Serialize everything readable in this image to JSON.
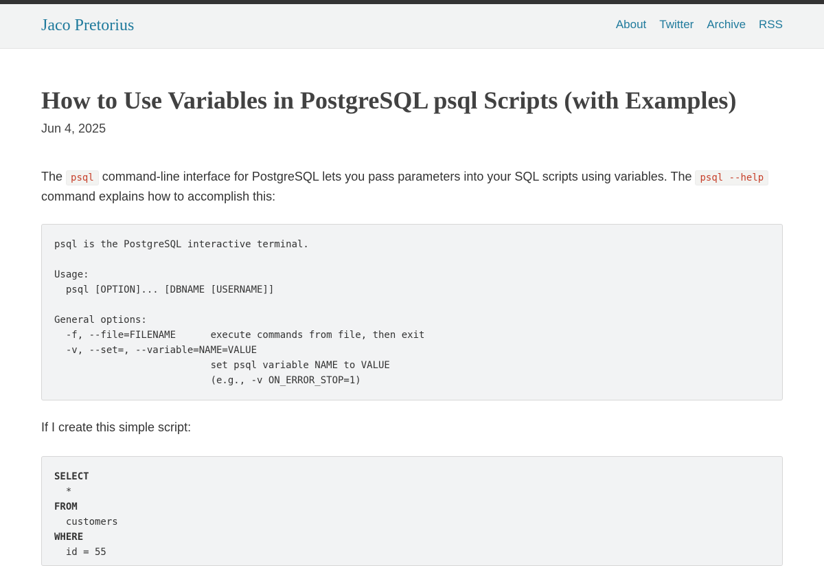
{
  "header": {
    "site_title": "Jaco Pretorius",
    "nav": [
      {
        "label": "About"
      },
      {
        "label": "Twitter"
      },
      {
        "label": "Archive"
      },
      {
        "label": "RSS"
      }
    ]
  },
  "post": {
    "title": "How to Use Variables in PostgreSQL psql Scripts (with Examples)",
    "date": "Jun 4, 2025",
    "intro": {
      "t1": "The ",
      "code1": "psql",
      "t2": " command-line interface for PostgreSQL lets you pass parameters into your SQL scripts using variables. The ",
      "code2": "psql --help",
      "t3": " command explains how to accomplish this:"
    },
    "help_output": "psql is the PostgreSQL interactive terminal.\n\nUsage:\n  psql [OPTION]... [DBNAME [USERNAME]]\n\nGeneral options:\n  -f, --file=FILENAME      execute commands from file, then exit\n  -v, --set=, --variable=NAME=VALUE\n                           set psql variable NAME to VALUE\n                           (e.g., -v ON_ERROR_STOP=1)",
    "script_intro": "If I create this simple script:",
    "script_lines": [
      {
        "kw": "SELECT",
        "text": ""
      },
      {
        "kw": "",
        "text": "  *"
      },
      {
        "kw": "FROM",
        "text": ""
      },
      {
        "kw": "",
        "text": "  customers"
      },
      {
        "kw": "WHERE",
        "text": ""
      },
      {
        "kw": "",
        "text": "  id = 55"
      }
    ]
  }
}
